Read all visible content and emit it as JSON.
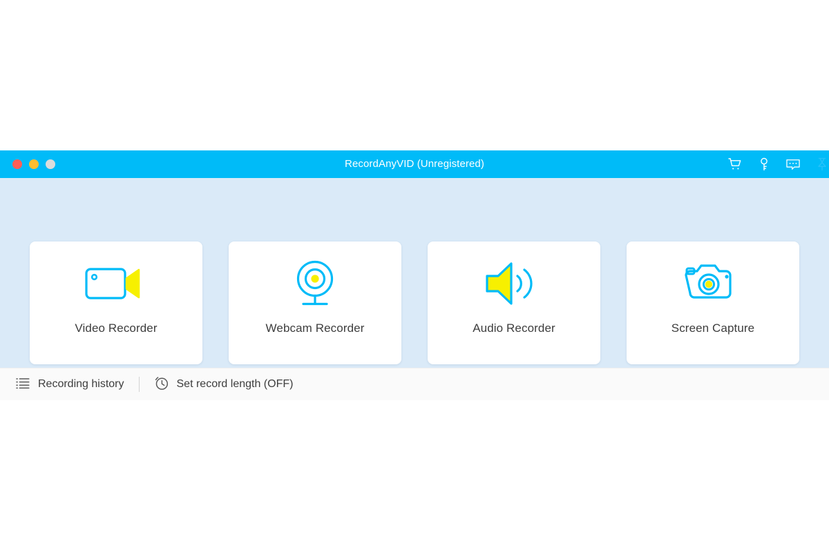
{
  "window": {
    "title": "RecordAnyVID (Unregistered)",
    "traffic_lights": [
      {
        "name": "close",
        "color": "#ff5f57"
      },
      {
        "name": "minimize",
        "color": "#ffbd2e"
      },
      {
        "name": "zoom",
        "color": "#dcdcdc"
      }
    ],
    "titlebar_color": "#00bbf8",
    "title_actions": [
      {
        "name": "cart-icon",
        "label": "Buy"
      },
      {
        "name": "key-icon",
        "label": "Register"
      },
      {
        "name": "feedback-icon",
        "label": "Feedback"
      },
      {
        "name": "pin-icon",
        "label": "Pin"
      }
    ]
  },
  "main": {
    "background_color": "#daeaf8",
    "accent_color": "#00bbf8",
    "highlight_color": "#f7f000",
    "cards": [
      {
        "label": "Video Recorder",
        "icon": "video-camera-icon"
      },
      {
        "label": "Webcam Recorder",
        "icon": "webcam-icon"
      },
      {
        "label": "Audio Recorder",
        "icon": "speaker-icon"
      },
      {
        "label": "Screen Capture",
        "icon": "camera-icon"
      }
    ]
  },
  "bottombar": {
    "background_color": "#fafafa",
    "recording_history_label": "Recording history",
    "record_length_label": "Set record length (OFF)"
  }
}
